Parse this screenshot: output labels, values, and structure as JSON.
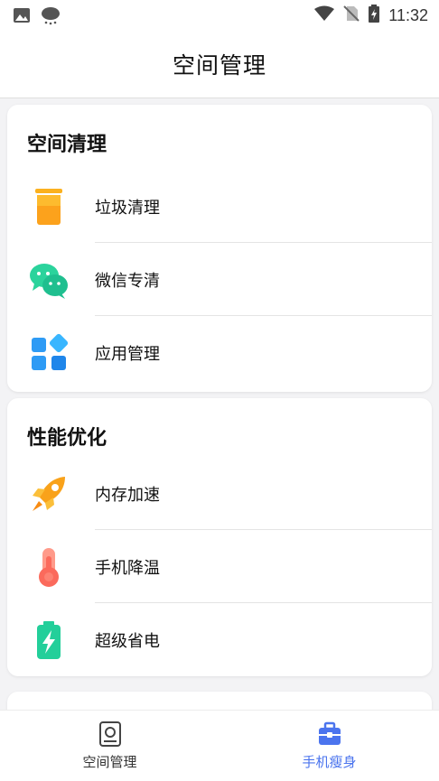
{
  "status_bar": {
    "time": "11:32"
  },
  "header": {
    "title": "空间管理"
  },
  "sections": [
    {
      "title": "空间清理",
      "items": [
        {
          "label": "垃圾清理",
          "icon": "trash-bin-icon"
        },
        {
          "label": "微信专清",
          "icon": "wechat-icon"
        },
        {
          "label": "应用管理",
          "icon": "apps-grid-icon"
        }
      ]
    },
    {
      "title": "性能优化",
      "items": [
        {
          "label": "内存加速",
          "icon": "rocket-icon"
        },
        {
          "label": "手机降温",
          "icon": "thermometer-icon"
        },
        {
          "label": "超级省电",
          "icon": "battery-icon"
        }
      ]
    }
  ],
  "bottom_nav": {
    "items": [
      {
        "label": "空间管理",
        "active": false,
        "icon": "storage-icon"
      },
      {
        "label": "手机瘦身",
        "active": true,
        "icon": "briefcase-icon"
      }
    ],
    "active_color": "#4b74ee",
    "inactive_color": "#333333"
  }
}
